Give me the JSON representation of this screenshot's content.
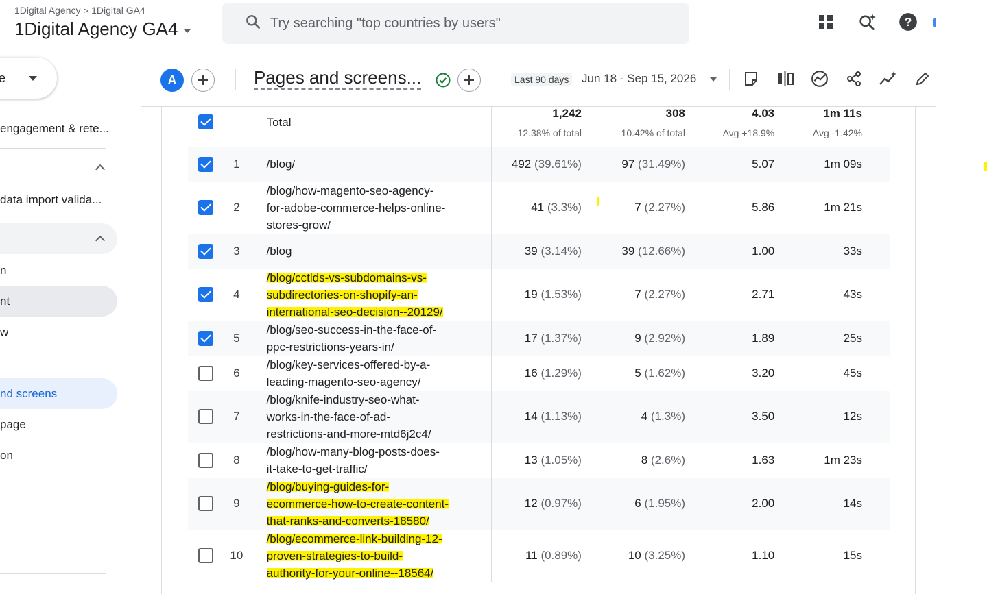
{
  "header": {
    "breadcrumb_account": "1Digital Agency",
    "breadcrumb_sep": ">",
    "breadcrumb_property": "1Digital GA4",
    "property_title": "1Digital Agency GA4",
    "search_placeholder": "Try searching \"top countries by users\"",
    "icons": [
      "apps-grid-icon",
      "search-insights-icon",
      "help-icon"
    ]
  },
  "sidebar": {
    "select_value": "e",
    "items": [
      {
        "label": "engagement & rete..."
      },
      {
        "label": "data import valida..."
      },
      {
        "label": "n"
      },
      {
        "label": "nt"
      },
      {
        "label": "w"
      },
      {
        "label": "nd screens"
      },
      {
        "label": "page"
      },
      {
        "label": "on"
      }
    ]
  },
  "toolbar": {
    "avatar_letter": "A",
    "report_title": "Pages and screens...",
    "date_label": "Last 90 days",
    "date_range": "Jun 18 - Sep 15, 2026",
    "icons": [
      "notes-icon",
      "compare-icon",
      "insights-icon",
      "share-icon",
      "trending-icon",
      "edit-icon"
    ]
  },
  "colors": {
    "accent": "#1a73e8",
    "highlight": "#fff200",
    "success": "#188038"
  },
  "table": {
    "totals": {
      "label": "Total",
      "views": "1,242",
      "views_sub": "12.38% of total",
      "users": "308",
      "users_sub": "10.42% of total",
      "views_per_user": "4.03",
      "views_per_user_sub": "Avg +18.9%",
      "engagement_time": "1m 11s",
      "engagement_time_sub": "Avg -1.42%"
    },
    "rows": [
      {
        "n": "1",
        "checked": true,
        "page": [
          "/blog/"
        ],
        "views": "492",
        "views_pct": "(39.61%)",
        "users": "97",
        "users_pct": "(31.49%)",
        "vpu": "5.07",
        "time": "1m 09s",
        "highlighted": false
      },
      {
        "n": "2",
        "checked": true,
        "page": [
          "/blog/how-magento-seo-agency-",
          "for-adobe-commerce-helps-online-",
          "stores-grow/"
        ],
        "views": "41",
        "views_pct": "(3.3%)",
        "users": "7",
        "users_pct": "(2.27%)",
        "vpu": "5.86",
        "time": "1m 21s",
        "highlighted": false
      },
      {
        "n": "3",
        "checked": true,
        "page": [
          "/blog"
        ],
        "views": "39",
        "views_pct": "(3.14%)",
        "users": "39",
        "users_pct": "(12.66%)",
        "vpu": "1.00",
        "time": "33s",
        "highlighted": false
      },
      {
        "n": "4",
        "checked": true,
        "page": [
          "/blog/cctlds-vs-subdomains-vs-",
          "subdirectories-on-shopify-an-",
          "international-seo-decision--20129/"
        ],
        "views": "19",
        "views_pct": "(1.53%)",
        "users": "7",
        "users_pct": "(2.27%)",
        "vpu": "2.71",
        "time": "43s",
        "highlighted": true
      },
      {
        "n": "5",
        "checked": true,
        "page": [
          "/blog/seo-success-in-the-face-of-",
          "ppc-restrictions-years-in/"
        ],
        "views": "17",
        "views_pct": "(1.37%)",
        "users": "9",
        "users_pct": "(2.92%)",
        "vpu": "1.89",
        "time": "25s",
        "highlighted": false
      },
      {
        "n": "6",
        "checked": false,
        "page": [
          "/blog/key-services-offered-by-a-",
          "leading-magento-seo-agency/"
        ],
        "views": "16",
        "views_pct": "(1.29%)",
        "users": "5",
        "users_pct": "(1.62%)",
        "vpu": "3.20",
        "time": "45s",
        "highlighted": false
      },
      {
        "n": "7",
        "checked": false,
        "page": [
          "/blog/knife-industry-seo-what-",
          "works-in-the-face-of-ad-",
          "restrictions-and-more-mtd6j2c4/"
        ],
        "views": "14",
        "views_pct": "(1.13%)",
        "users": "4",
        "users_pct": "(1.3%)",
        "vpu": "3.50",
        "time": "12s",
        "highlighted": false
      },
      {
        "n": "8",
        "checked": false,
        "page": [
          "/blog/how-many-blog-posts-does-",
          "it-take-to-get-traffic/"
        ],
        "views": "13",
        "views_pct": "(1.05%)",
        "users": "8",
        "users_pct": "(2.6%)",
        "vpu": "1.63",
        "time": "1m 23s",
        "highlighted": false
      },
      {
        "n": "9",
        "checked": false,
        "page": [
          "/blog/buying-guides-for-",
          "ecommerce-how-to-create-content-",
          "that-ranks-and-converts-18580/"
        ],
        "views": "12",
        "views_pct": "(0.97%)",
        "users": "6",
        "users_pct": "(1.95%)",
        "vpu": "2.00",
        "time": "14s",
        "highlighted": true
      },
      {
        "n": "10",
        "checked": false,
        "page": [
          "/blog/ecommerce-link-building-12-",
          "proven-strategies-to-build-",
          "authority-for-your-online--18564/"
        ],
        "views": "11",
        "views_pct": "(0.89%)",
        "users": "10",
        "users_pct": "(3.25%)",
        "vpu": "1.10",
        "time": "15s",
        "highlighted": true
      }
    ]
  }
}
